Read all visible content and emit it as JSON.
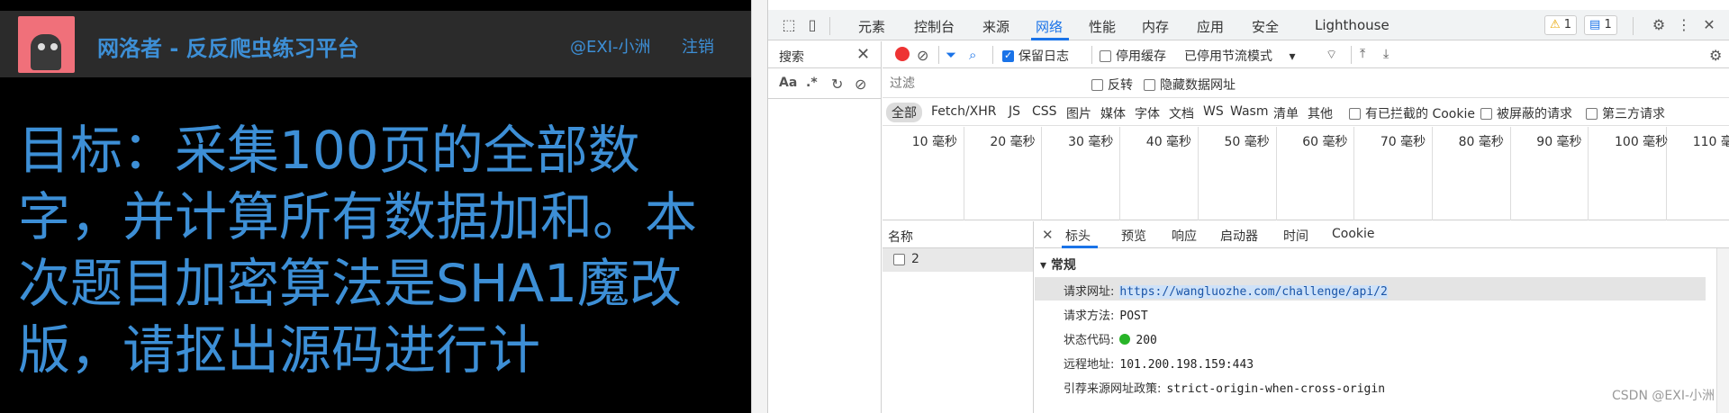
{
  "page": {
    "brand": "网洛者 - 反反爬虫练习平台",
    "user": "@EXI-小洲",
    "logout": "注销",
    "headline": "目标：采集100页的全部数字，并计算所有数据加和。本次题目加密算法是SHA1魔改版，请抠出源码进行计"
  },
  "devtools": {
    "tabs": [
      "元素",
      "控制台",
      "来源",
      "网络",
      "性能",
      "内存",
      "应用",
      "安全",
      "Lighthouse"
    ],
    "active_tab": "网络",
    "warn_count": "1",
    "msg_count": "1",
    "search_panel": {
      "title": "搜索",
      "case": "Aa",
      "regex": ".*"
    },
    "toolbar": {
      "preserve_log": "保留日志",
      "disable_cache": "停用缓存",
      "throttle": "已停用节流模式"
    },
    "filter": {
      "placeholder": "过滤",
      "invert": "反转",
      "hide_data_urls": "隐藏数据网址"
    },
    "types": [
      "全部",
      "Fetch/XHR",
      "JS",
      "CSS",
      "图片",
      "媒体",
      "字体",
      "文档",
      "WS",
      "Wasm",
      "清单",
      "其他"
    ],
    "type_checks": [
      "有已拦截的 Cookie",
      "被屏蔽的请求",
      "第三方请求"
    ],
    "timeline_ticks": [
      "10 毫秒",
      "20 毫秒",
      "30 毫秒",
      "40 毫秒",
      "50 毫秒",
      "60 毫秒",
      "70 毫秒",
      "80 毫秒",
      "90 毫秒",
      "100 毫秒",
      "110 毫"
    ],
    "names_header": "名称",
    "request_name": "2",
    "detail_tabs": [
      "标头",
      "预览",
      "响应",
      "启动器",
      "时间",
      "Cookie"
    ],
    "section": "常规",
    "general": {
      "url_label": "请求网址:",
      "url": "https://wangluozhe.com/challenge/api/2",
      "method_label": "请求方法:",
      "method": "POST",
      "status_label": "状态代码:",
      "status": "200",
      "remote_label": "远程地址:",
      "remote": "101.200.198.159:443",
      "referrer_label": "引荐来源网址政策:",
      "referrer": "strict-origin-when-cross-origin"
    },
    "watermark": "CSDN @EXI-小洲"
  }
}
